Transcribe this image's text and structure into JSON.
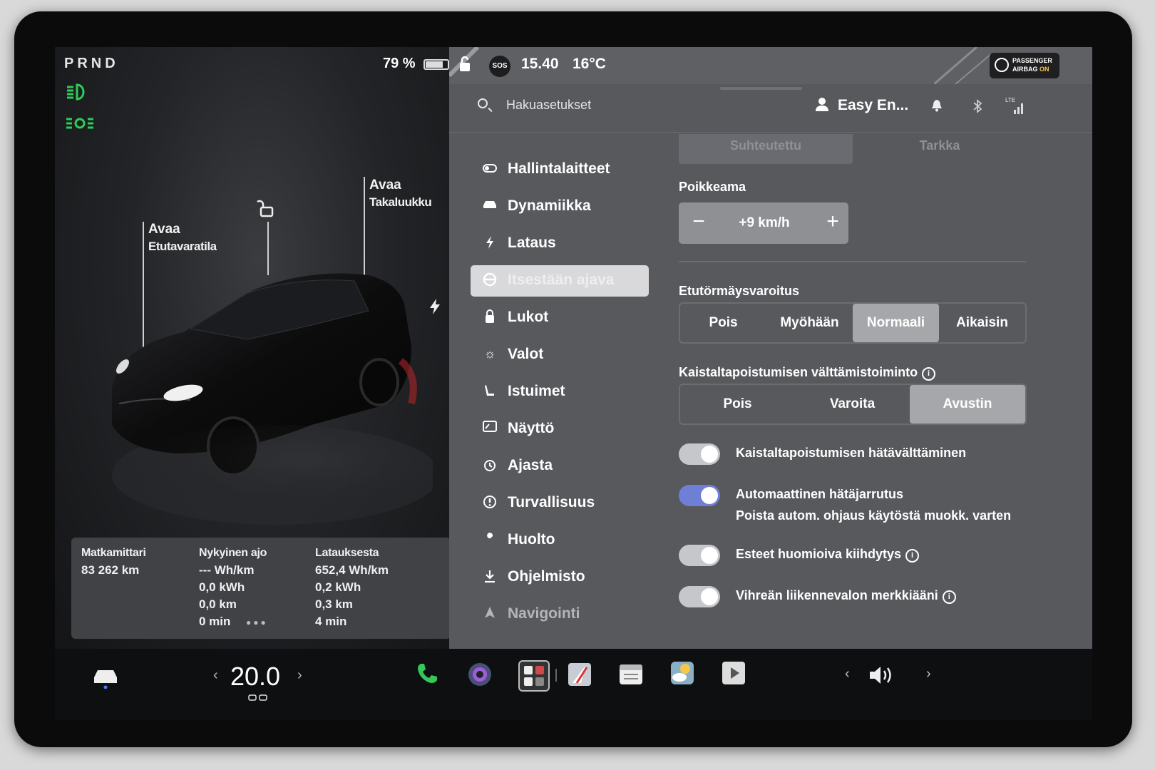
{
  "drive": {
    "gear": "PRND",
    "battery_percent": "79 %",
    "battery_level": 0.79,
    "headlight_icon": "headlight-icon",
    "parking_light_icon": "parking-light-icon"
  },
  "car_view": {
    "frunk_label_1": "Avaa",
    "frunk_label_2": "Etutavaratila",
    "trunk_label_1": "Avaa",
    "trunk_label_2": "Takaluukku"
  },
  "trip": {
    "odometer": {
      "title": "Matkamittari",
      "value": "83 262 km"
    },
    "current": {
      "title": "Nykyinen ajo",
      "lines": [
        "--- Wh/km",
        "0,0 kWh",
        "0,0 km",
        "0 min"
      ]
    },
    "since_charge": {
      "title": "Latauksesta",
      "lines": [
        "652,4 Wh/km",
        "0,2 kWh",
        "0,3 km",
        "4 min"
      ]
    }
  },
  "status": {
    "sos": "SOS",
    "time": "15.40",
    "temperature": "16°C",
    "airbag_line1": "PASSENGER",
    "airbag_line2": "AIRBAG",
    "airbag_state": "ON"
  },
  "header": {
    "search_placeholder": "Hakuasetukset",
    "profile_name": "Easy En...",
    "lte": "LTE"
  },
  "nav": [
    {
      "label": "Hallintalaitteet",
      "icon": "toggle-icon"
    },
    {
      "label": "Dynamiikka",
      "icon": "car-icon"
    },
    {
      "label": "Lataus",
      "icon": "bolt-icon"
    },
    {
      "label": "Itsestään ajava",
      "icon": "steering-wheel-icon"
    },
    {
      "label": "Lukot",
      "icon": "lock-icon"
    },
    {
      "label": "Valot",
      "icon": "sun-icon"
    },
    {
      "label": "Istuimet",
      "icon": "seat-icon"
    },
    {
      "label": "Näyttö",
      "icon": "display-icon"
    },
    {
      "label": "Ajasta",
      "icon": "alarm-icon"
    },
    {
      "label": "Turvallisuus",
      "icon": "info-icon"
    },
    {
      "label": "Huolto",
      "icon": "wrench-icon"
    },
    {
      "label": "Ohjelmisto",
      "icon": "download-icon"
    },
    {
      "label": "Navigointi",
      "icon": "navigation-icon"
    }
  ],
  "settings": {
    "top_options": [
      "Suhteutettu",
      "Tarkka"
    ],
    "offset_title": "Poikkeama",
    "offset_value": "+9 km/h",
    "fcw_title": "Etutörmäysvaroitus",
    "fcw_options": [
      "Pois",
      "Myöhään",
      "Normaali",
      "Aikaisin"
    ],
    "fcw_selected": "Normaali",
    "lda_title": "Kaistaltapoistumisen välttämistoiminto",
    "lda_options": [
      "Pois",
      "Varoita",
      "Avustin"
    ],
    "lda_selected": "Avustin",
    "toggles": [
      {
        "label": "Kaistaltapoistumisen hätävälttäminen",
        "on": true
      },
      {
        "label": "Automaattinen hätäjarrutus",
        "sub": "Poista autom. ohjaus käytöstä muokk. varten",
        "on": true
      },
      {
        "label": "Esteet huomioiva kiihdytys",
        "on": true
      },
      {
        "label": "Vihreän liikennevalon merkkiääni",
        "on": true
      }
    ]
  },
  "dock": {
    "cabin_temp": "20.0"
  }
}
